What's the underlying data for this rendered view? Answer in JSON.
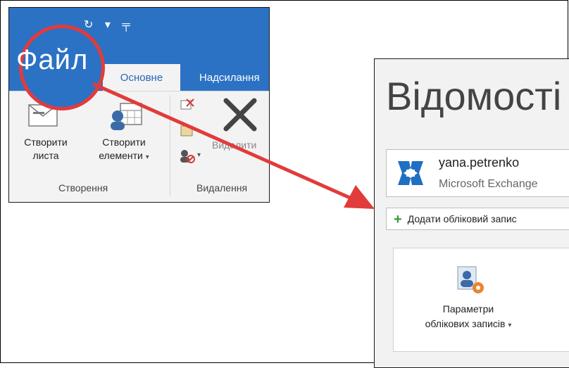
{
  "ribbon": {
    "file_label": "Файл",
    "tabs": [
      {
        "label": "Основне",
        "active": true
      },
      {
        "label": "Надсилання",
        "active": false
      }
    ],
    "commands": {
      "new_email": {
        "line1": "Створити",
        "line2": "листа"
      },
      "new_items": {
        "line1": "Створити",
        "line2": "елементи"
      },
      "delete_partial": "Видалити"
    },
    "groups": {
      "create": "Створення",
      "delete": "Видалення"
    }
  },
  "info": {
    "title": "Відомості",
    "account": {
      "name": "yana.petrenko",
      "type": "Microsoft Exchange"
    },
    "add_account_label": "Додати обліковий запис",
    "account_settings": {
      "line1": "Параметри",
      "line2": "облікових записів"
    }
  },
  "colors": {
    "ribbon_blue": "#2b72c4",
    "callout_red": "#e23b3b",
    "add_green": "#3a9a3a"
  }
}
